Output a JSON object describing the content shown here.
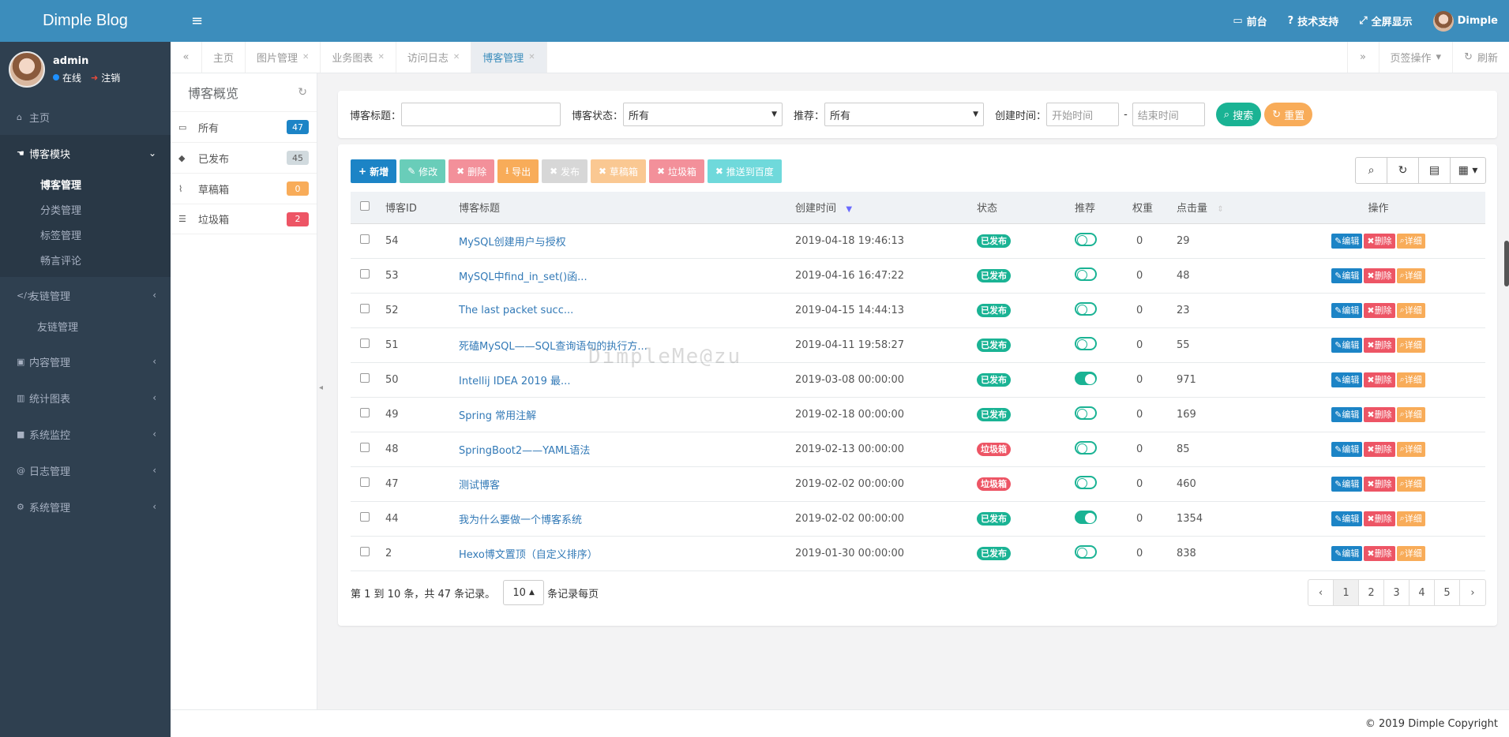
{
  "app": {
    "brand": "Dimple Blog"
  },
  "user": {
    "name": "admin",
    "status": "在线",
    "logout": "注销"
  },
  "sidebar": {
    "items": [
      {
        "label": "主页",
        "icon": "home-icon"
      },
      {
        "label": "博客模块",
        "icon": "hand-icon",
        "expanded": true,
        "children": [
          {
            "label": "博客管理"
          },
          {
            "label": "分类管理"
          },
          {
            "label": "标签管理"
          },
          {
            "label": "畅言评论"
          }
        ]
      },
      {
        "label": "友链管理",
        "icon": "code-icon",
        "children": [
          {
            "label": "友链管理"
          }
        ]
      },
      {
        "label": "内容管理",
        "icon": "folder-icon"
      },
      {
        "label": "统计图表",
        "icon": "bar-chart-icon"
      },
      {
        "label": "系统监控",
        "icon": "video-icon"
      },
      {
        "label": "日志管理",
        "icon": "at-icon"
      },
      {
        "label": "系统管理",
        "icon": "gear-icon"
      }
    ]
  },
  "navbar": {
    "front": "前台",
    "support": "技术支持",
    "fullscreen": "全屏显示",
    "username": "Dimple"
  },
  "tabs": {
    "items": [
      "主页",
      "图片管理",
      "业务图表",
      "访问日志",
      "博客管理"
    ],
    "active": "博客管理",
    "page_ops": "页签操作",
    "refresh": "刷新"
  },
  "overview": {
    "title": "博客概览",
    "items": [
      {
        "label": "所有",
        "count": "47",
        "color": "#1c84c6"
      },
      {
        "label": "已发布",
        "count": "45",
        "color": "#d1dade"
      },
      {
        "label": "草稿箱",
        "count": "0",
        "color": "#f8ac59"
      },
      {
        "label": "垃圾箱",
        "count": "2",
        "color": "#ed5565"
      }
    ]
  },
  "search": {
    "title_label": "博客标题：",
    "status_label": "博客状态：",
    "status_value": "所有",
    "recommend_label": "推荐：",
    "recommend_value": "所有",
    "created_label": "创建时间：",
    "start_placeholder": "开始时间",
    "end_placeholder": "结束时间",
    "dash": "-",
    "search_btn": "搜索",
    "reset_btn": "重置"
  },
  "toolbar": {
    "add": "新增",
    "edit": "修改",
    "remove": "删除",
    "export": "导出",
    "publish": "发布",
    "draft": "草稿箱",
    "trash": "垃圾箱",
    "baidu": "推送到百度"
  },
  "table": {
    "headers": {
      "id": "博客ID",
      "title": "博客标题",
      "created": "创建时间",
      "status": "状态",
      "recommend": "推荐",
      "weight": "权重",
      "clicks": "点击量",
      "ops": "操作"
    },
    "op_labels": {
      "edit": "编辑",
      "delete": "删除",
      "detail": "详细"
    },
    "rows": [
      {
        "id": "54",
        "title": "MySQL创建用户与授权",
        "created": "2019-04-18 19:46:13",
        "status": "已发布",
        "status_color": "#1ab394",
        "recommend": false,
        "weight": "0",
        "clicks": "29"
      },
      {
        "id": "53",
        "title": "MySQL中find_in_set()函...",
        "created": "2019-04-16 16:47:22",
        "status": "已发布",
        "status_color": "#1ab394",
        "recommend": false,
        "weight": "0",
        "clicks": "48"
      },
      {
        "id": "52",
        "title": "The last packet succ...",
        "created": "2019-04-15 14:44:13",
        "status": "已发布",
        "status_color": "#1ab394",
        "recommend": false,
        "weight": "0",
        "clicks": "23"
      },
      {
        "id": "51",
        "title": "死磕MySQL——SQL查询语句的执行方...",
        "created": "2019-04-11 19:58:27",
        "status": "已发布",
        "status_color": "#1ab394",
        "recommend": false,
        "weight": "0",
        "clicks": "55"
      },
      {
        "id": "50",
        "title": "Intellij IDEA 2019 最...",
        "created": "2019-03-08 00:00:00",
        "status": "已发布",
        "status_color": "#1ab394",
        "recommend": true,
        "weight": "0",
        "clicks": "971"
      },
      {
        "id": "49",
        "title": "Spring 常用注解",
        "created": "2019-02-18 00:00:00",
        "status": "已发布",
        "status_color": "#1ab394",
        "recommend": false,
        "weight": "0",
        "clicks": "169"
      },
      {
        "id": "48",
        "title": "SpringBoot2——YAML语法",
        "created": "2019-02-13 00:00:00",
        "status": "垃圾箱",
        "status_color": "#ed5565",
        "recommend": false,
        "weight": "0",
        "clicks": "85"
      },
      {
        "id": "47",
        "title": "测试博客",
        "created": "2019-02-02 00:00:00",
        "status": "垃圾箱",
        "status_color": "#ed5565",
        "recommend": false,
        "weight": "0",
        "clicks": "460"
      },
      {
        "id": "44",
        "title": "我为什么要做一个博客系统",
        "created": "2019-02-02 00:00:00",
        "status": "已发布",
        "status_color": "#1ab394",
        "recommend": true,
        "weight": "0",
        "clicks": "1354"
      },
      {
        "id": "2",
        "title": "Hexo博文置顶（自定义排序）",
        "created": "2019-01-30 00:00:00",
        "status": "已发布",
        "status_color": "#1ab394",
        "recommend": false,
        "weight": "0",
        "clicks": "838"
      }
    ]
  },
  "pagination": {
    "summary": "第 1 到 10 条，共 47 条记录。",
    "page_size": "10",
    "per_page": "条记录每页",
    "prev": "‹",
    "next": "›",
    "pages": [
      "1",
      "2",
      "3",
      "4",
      "5"
    ]
  },
  "watermark": "DimpleMe@zu",
  "footer": "© 2019 Dimple Copyright",
  "colors": {
    "primary": "#1c84c6",
    "success": "#1ab394",
    "danger": "#ed5565",
    "warning": "#f8ac59",
    "info": "#23c6c8",
    "nav": "#3c8dbc",
    "sidebar": "#2f4050"
  }
}
